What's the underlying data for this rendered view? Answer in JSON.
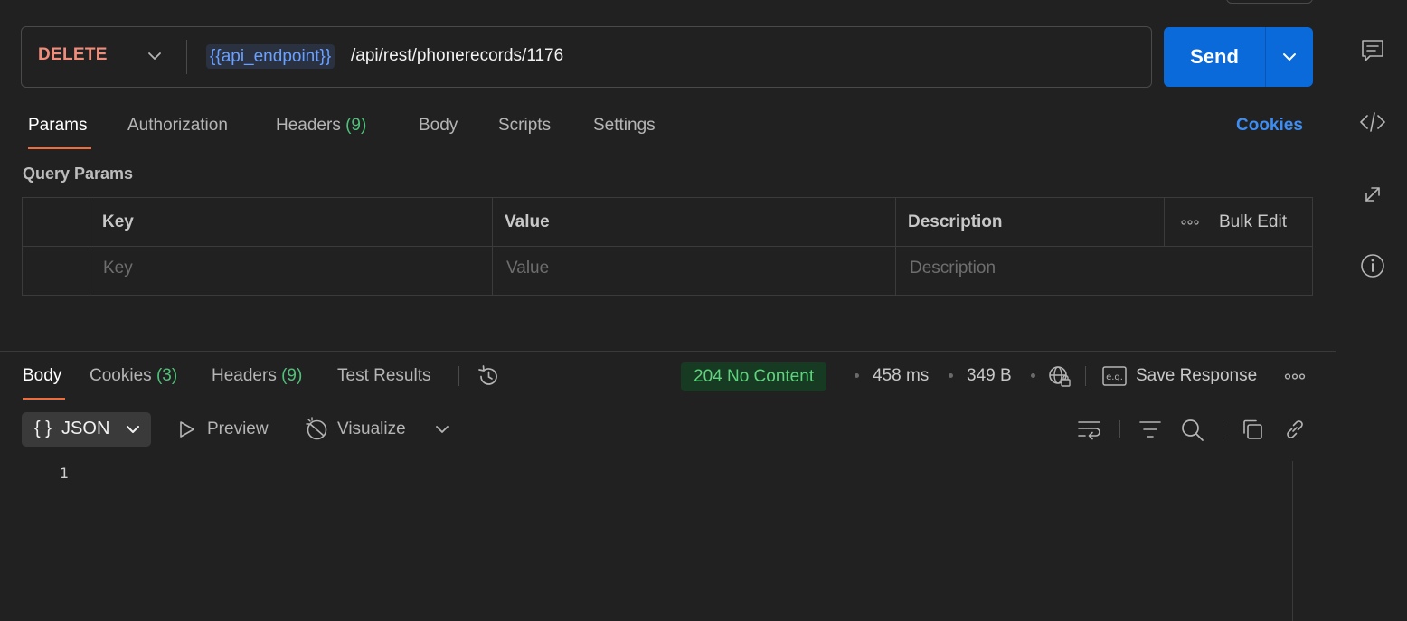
{
  "request": {
    "method": "DELETE",
    "url_variable": "{{api_endpoint}}",
    "url_path": "/api/rest/phonerecords/1176",
    "send_label": "Send"
  },
  "request_tabs": [
    {
      "label": "Params"
    },
    {
      "label": "Authorization"
    },
    {
      "label": "Headers",
      "count": "(9)"
    },
    {
      "label": "Body"
    },
    {
      "label": "Scripts"
    },
    {
      "label": "Settings"
    }
  ],
  "cookies_link": "Cookies",
  "query_params": {
    "title": "Query Params",
    "columns": [
      "Key",
      "Value",
      "Description"
    ],
    "bulk_edit": "Bulk Edit",
    "placeholders": {
      "key": "Key",
      "value": "Value",
      "description": "Description"
    }
  },
  "response": {
    "tabs": [
      {
        "label": "Body"
      },
      {
        "label": "Cookies",
        "count": "(3)"
      },
      {
        "label": "Headers",
        "count": "(9)"
      },
      {
        "label": "Test Results"
      }
    ],
    "status": "204 No Content",
    "time": "458 ms",
    "size": "349 B",
    "save_response": "Save Response",
    "format": "JSON",
    "format_icon": "{ }",
    "preview": "Preview",
    "visualize": "Visualize",
    "line_numbers": [
      "1"
    ]
  },
  "colors": {
    "method": "#f08c7a",
    "send": "#0a6ad9",
    "accent": "#f26b3a",
    "status_ok": "#5fd37e",
    "link": "#3c8ef5"
  }
}
